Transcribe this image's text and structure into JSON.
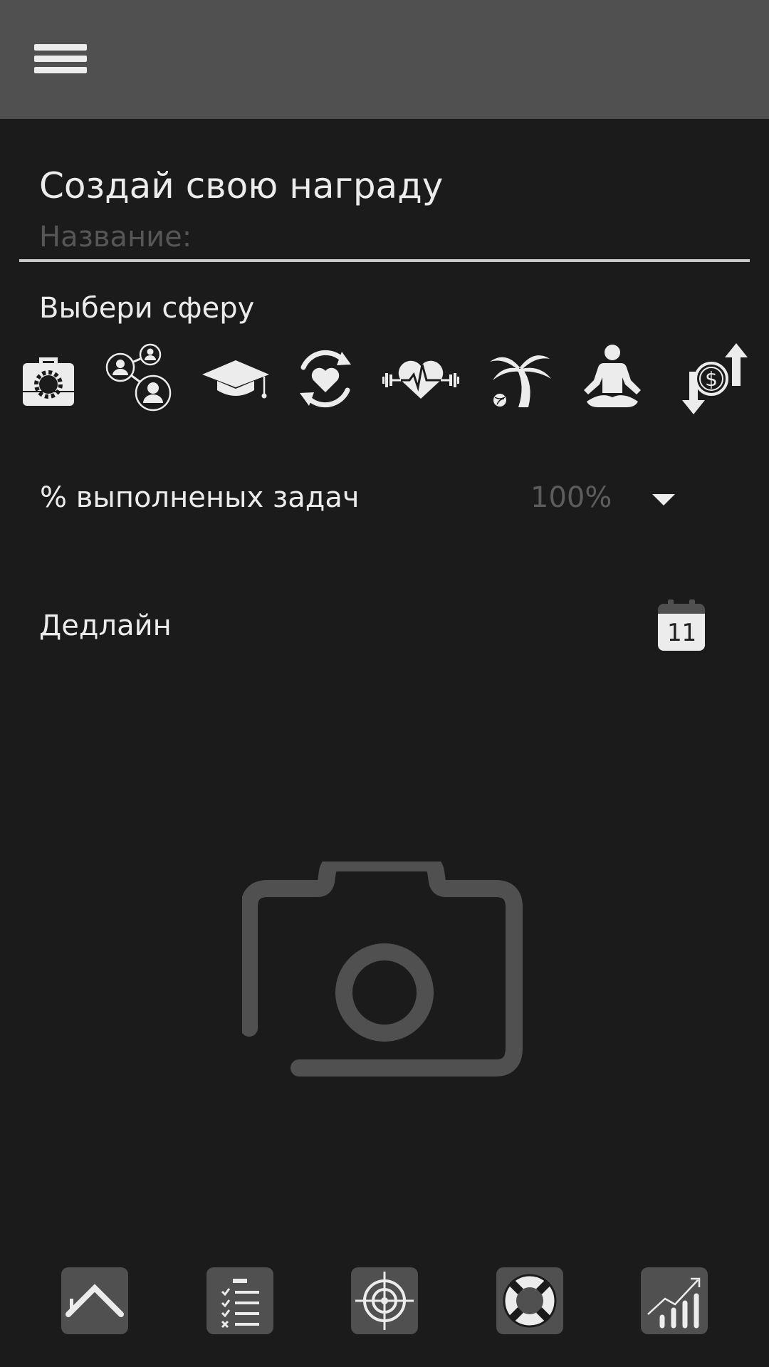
{
  "header": {
    "menu_icon": "hamburger-menu-icon"
  },
  "form": {
    "title": "Создай свою награду",
    "name_value": "",
    "name_placeholder": "Название:",
    "sphere_label": "Выбери сферу",
    "spheres": [
      {
        "icon": "work-briefcase-icon"
      },
      {
        "icon": "social-network-icon"
      },
      {
        "icon": "education-cap-icon"
      },
      {
        "icon": "relationships-heart-cycle-icon"
      },
      {
        "icon": "health-fitness-icon"
      },
      {
        "icon": "leisure-palm-icon"
      },
      {
        "icon": "spiritual-meditation-icon"
      },
      {
        "icon": "finance-money-icon"
      }
    ],
    "completion_label": "% выполненых задач",
    "completion_value": "100%",
    "deadline_label": "Дедлайн",
    "calendar_day": "11",
    "photo_icon": "camera-icon"
  },
  "bottom_nav": [
    {
      "icon": "home-icon"
    },
    {
      "icon": "task-list-icon"
    },
    {
      "icon": "target-icon"
    },
    {
      "icon": "lifebuoy-icon"
    },
    {
      "icon": "stats-chart-icon"
    }
  ],
  "colors": {
    "background": "#1b1b1b",
    "app_bar": "#505050",
    "text": "#ececec",
    "muted_text": "#5c5c5c",
    "nav_button": "#505050"
  }
}
